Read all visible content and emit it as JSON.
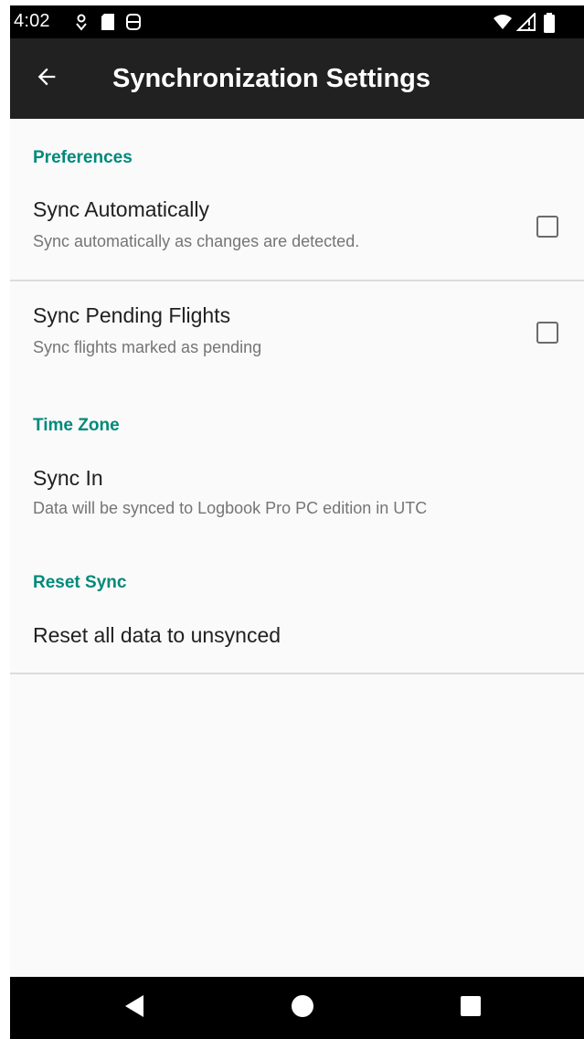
{
  "status_bar": {
    "time": "4:02",
    "left_icons": [
      "location-pin-icon",
      "sd-card-icon",
      "sync-status-icon"
    ],
    "right_icons": [
      "wifi-icon",
      "signal-icon",
      "battery-icon"
    ]
  },
  "app_bar": {
    "back_icon": "arrow-back-icon",
    "title": "Synchronization Settings"
  },
  "sections": {
    "preferences": {
      "header": "Preferences",
      "sync_automatically": {
        "title": "Sync Automatically",
        "summary": "Sync automatically as changes are detected.",
        "checked": false
      },
      "sync_pending": {
        "title": "Sync Pending Flights",
        "summary": "Sync flights marked as pending",
        "checked": false
      }
    },
    "time_zone": {
      "header": "Time Zone",
      "sync_in": {
        "title": "Sync In",
        "summary": "Data will be synced to Logbook Pro PC edition in UTC"
      }
    },
    "reset_sync": {
      "header": "Reset Sync",
      "reset_all": {
        "title": "Reset all data to unsynced"
      }
    }
  },
  "nav_bar": {
    "icons": [
      "back-triangle-icon",
      "home-circle-icon",
      "recents-square-icon"
    ]
  },
  "colors": {
    "accent": "#00897b",
    "app_bar": "#212121",
    "background": "#fafafa",
    "title_text": "#212121",
    "summary_text": "#757575"
  }
}
